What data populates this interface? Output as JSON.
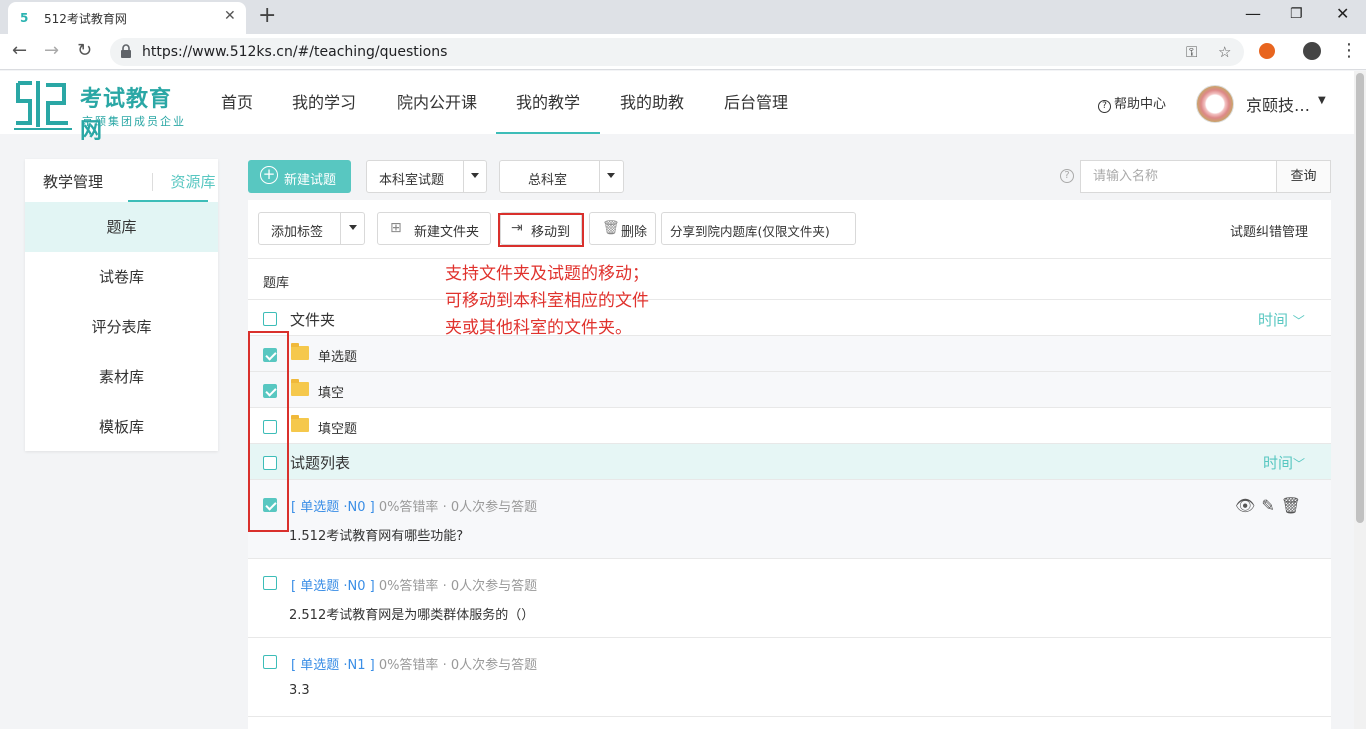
{
  "browser": {
    "tab_title": "512考试教育网",
    "url": "https://www.512ks.cn/#/teaching/questions"
  },
  "site": {
    "logo_title": "考试教育网",
    "logo_subtitle": "京颐集团成员企业",
    "nav": [
      "首页",
      "我的学习",
      "院内公开课",
      "我的教学",
      "我的助教",
      "后台管理"
    ],
    "active_nav": "我的教学",
    "help": "帮助中心",
    "username": "京颐技…"
  },
  "sidebar": {
    "tabs": [
      "教学管理",
      "资源库"
    ],
    "active_tab": "资源库",
    "items": [
      "题库",
      "试卷库",
      "评分表库",
      "素材库",
      "模板库"
    ],
    "active_item": "题库"
  },
  "filters": {
    "new_question": "新建试题",
    "scope_select": "本科室试题",
    "dept_select": "总科室",
    "search_placeholder": "请输入名称",
    "search_button": "查询"
  },
  "toolbar": {
    "add_tag": "添加标签",
    "new_folder": "新建文件夹",
    "move_to": "移动到",
    "delete": "删除",
    "share": "分享到院内题库(仅限文件夹)",
    "error_mgmt": "试题纠错管理"
  },
  "list": {
    "section_label": "题库",
    "folder_header": "文件夹",
    "sort_label": "时间",
    "folders": [
      {
        "name": "单选题",
        "checked": true
      },
      {
        "name": "填空",
        "checked": true
      },
      {
        "name": "填空题",
        "checked": false
      }
    ],
    "question_header": "试题列表",
    "questions": [
      {
        "tag": "[ 单选题 ·N0 ]",
        "stats": "0%答错率 · 0人次参与答题",
        "text": "1.512考试教育网有哪些功能?",
        "checked": true
      },
      {
        "tag": "[ 单选题 ·N0 ]",
        "stats": "0%答错率 · 0人次参与答题",
        "text": "2.512考试教育网是为哪类群体服务的（）",
        "checked": false
      },
      {
        "tag": "[ 单选题 ·N1 ]",
        "stats": "0%答错率 · 0人次参与答题",
        "text": "3.3",
        "checked": false
      }
    ]
  },
  "annotation": {
    "lines": [
      "支持文件夹及试题的移动；",
      "可移动到本科室相应的文件",
      "夹或其他科室的文件夹。"
    ],
    "color": "#e0322d"
  },
  "colors": {
    "accent": "#58c7c1",
    "highlight": "#d9302c",
    "tag_blue": "#3a8ee6"
  }
}
